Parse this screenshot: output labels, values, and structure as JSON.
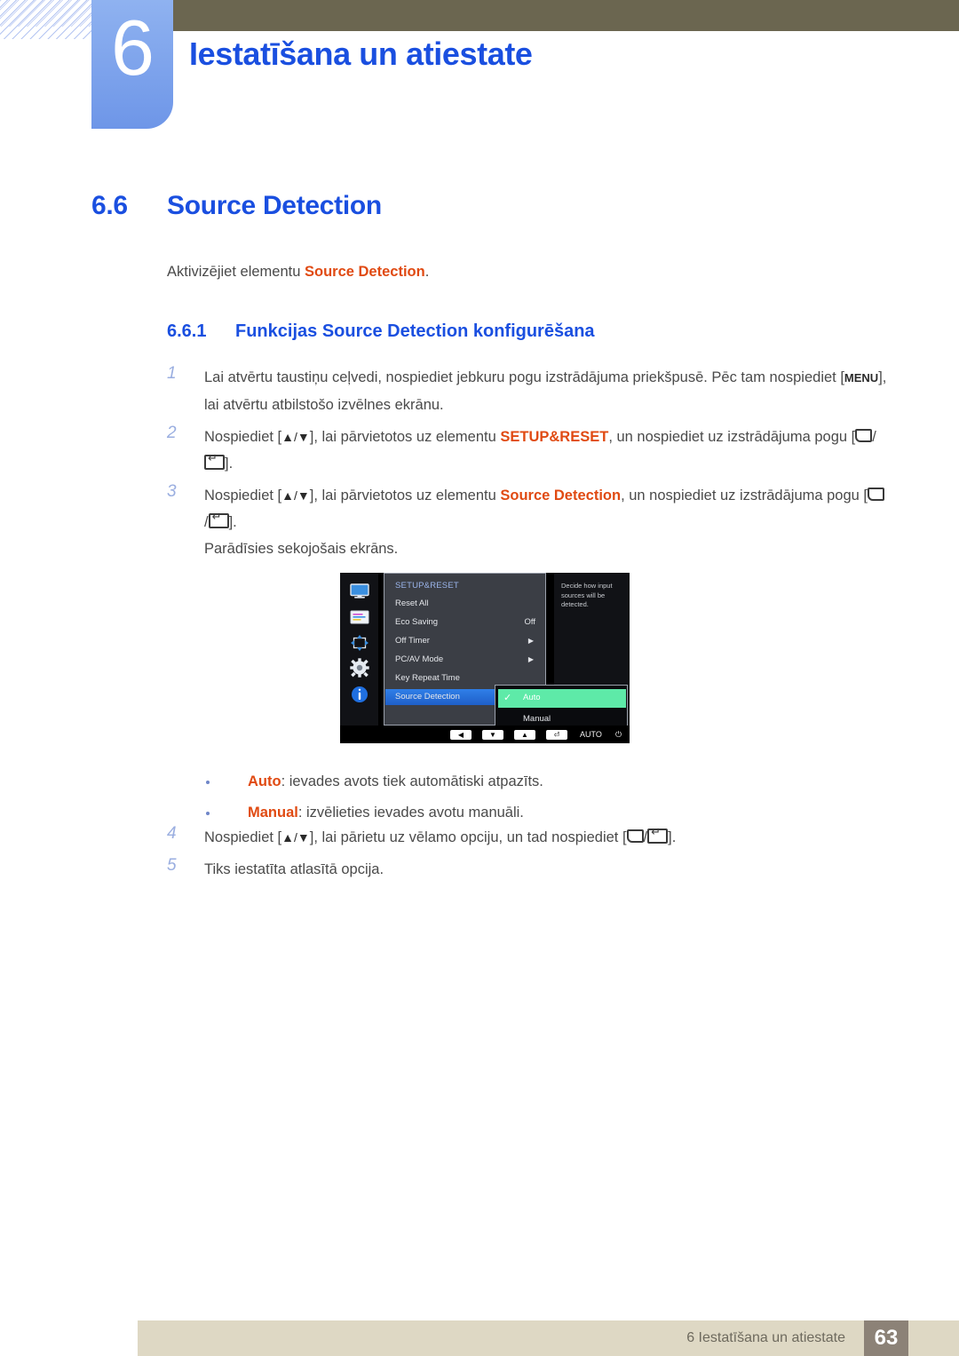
{
  "banner": {
    "chapter_number": "6",
    "chapter_title": "Iestatīšana un atiestate",
    "accent_blue": "#1a4fe0",
    "tab_blue": "#7ca2ee",
    "olive": "#6b6650"
  },
  "section": {
    "number": "6.6",
    "title": "Source Detection",
    "intro_prefix": "Aktivizējiet elementu ",
    "intro_highlight": "Source Detection",
    "intro_suffix": "."
  },
  "subsection": {
    "number": "6.6.1",
    "title": "Funkcijas Source Detection konfigurēšana"
  },
  "steps": [
    {
      "num": "1",
      "text_a": "Lai atvērtu taustiņu ceļvedi, nospiediet jebkuru pogu izstrādājuma priekšpusē. Pēc tam nospiediet [",
      "key": "MENU",
      "text_b": "], lai atvērtu atbilstošo izvēlnes ekrānu."
    },
    {
      "num": "2",
      "text_a": "Nospiediet [",
      "arrows": "▲/▼",
      "text_b": "], lai pārvietotos uz elementu ",
      "highlight": "SETUP&RESET",
      "text_c": ", un nospiediet uz izstrādājuma pogu [",
      "text_d": "]."
    },
    {
      "num": "3",
      "text_a": "Nospiediet [",
      "arrows": "▲/▼",
      "text_b": "], lai pārvietotos uz elementu ",
      "highlight": "Source Detection",
      "text_c": ", un nospiediet uz izstrādājuma pogu [",
      "text_d": "].",
      "extra": "Parādīsies sekojošais ekrāns."
    }
  ],
  "bullets": [
    {
      "term": "Auto",
      "rest": ": ievades avots tiek automātiski atpazīts."
    },
    {
      "term": "Manual",
      "rest": ": izvēlieties ievades avotu manuāli."
    }
  ],
  "steps2": [
    {
      "num": "4",
      "text_a": "Nospiediet [",
      "arrows": "▲/▼",
      "text_b": "], lai pārietu uz vēlamo opciju, un tad nospiediet [",
      "text_c": "]."
    },
    {
      "num": "5",
      "text_a": "Tiks iestatīta atlasītā opcija."
    }
  ],
  "osd": {
    "panel_title": "SETUP&RESET",
    "icons": [
      "monitor-icon",
      "picture-color-icon",
      "screen-adjust-icon",
      "gear-icon",
      "info-icon"
    ],
    "rows": [
      {
        "label": "Reset All",
        "value": "",
        "arrow": false
      },
      {
        "label": "Eco Saving",
        "value": "Off",
        "arrow": false
      },
      {
        "label": "Off Timer",
        "value": "",
        "arrow": true
      },
      {
        "label": "PC/AV Mode",
        "value": "",
        "arrow": true
      },
      {
        "label": "Key Repeat Time",
        "value": "",
        "arrow": false
      },
      {
        "label": "Source Detection",
        "value": "",
        "arrow": false,
        "selected": true
      }
    ],
    "help_text": "Decide how input sources will be detected.",
    "submenu": [
      {
        "label": "Auto",
        "checked": true,
        "highlight": true
      },
      {
        "label": "Manual",
        "checked": false,
        "highlight": false
      }
    ],
    "bottom_bar": {
      "keys": [
        "◀",
        "▼",
        "▲",
        "⏎"
      ],
      "auto_label": "AUTO",
      "power_glyph": "⏻"
    },
    "highlight_green": "#5eeaa8",
    "select_blue": "#2f7fe8"
  },
  "footer": {
    "text": "6 Iestatīšana un atiestate",
    "page": "63",
    "bar_color": "#ded8c4",
    "page_box_color": "#8c8277"
  }
}
